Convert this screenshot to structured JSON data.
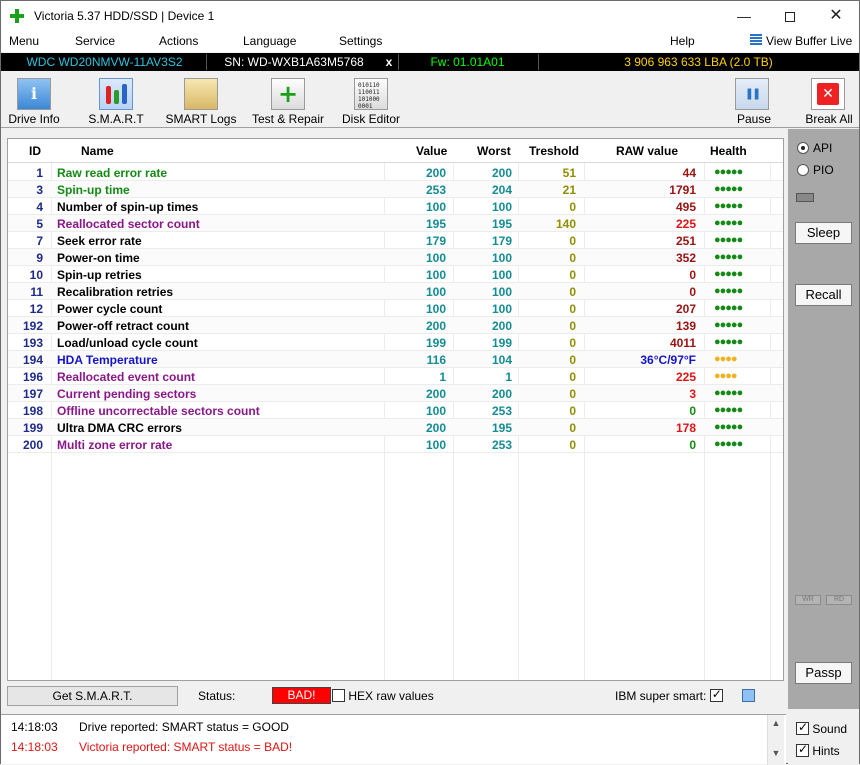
{
  "window": {
    "title": "Victoria 5.37 HDD/SSD | Device 1",
    "minimize": "—",
    "close": "✕"
  },
  "menu": [
    "Menu",
    "Service",
    "Actions",
    "Language",
    "Settings",
    "Help"
  ],
  "view_buffer": "View Buffer Live",
  "drive": {
    "model": "WDC WD20NMVW-11AV3S2",
    "serial": "SN: WD-WXB1A63M5768",
    "close": "x",
    "firmware": "Fw: 01.01A01",
    "lba": "3 906 963 633 LBA (2.0 TB)"
  },
  "toolbar": {
    "drive_info": "Drive Info",
    "smart": "S.M.A.R.T",
    "smart_logs": "SMART Logs",
    "test_repair": "Test & Repair",
    "disk_editor": "Disk Editor",
    "pause": "Pause",
    "break_all": "Break All"
  },
  "table": {
    "headers": {
      "id": "ID",
      "name": "Name",
      "value": "Value",
      "worst": "Worst",
      "threshold": "Treshold",
      "raw": "RAW value",
      "health": "Health"
    },
    "rows": [
      {
        "id": "1",
        "name": "Raw read error rate",
        "value": "200",
        "worst": "200",
        "threshold": "51",
        "raw": "44",
        "health": "●●●●●",
        "name_color": "#138a13",
        "raw_color": "#9a1313",
        "health_color": "#138a13"
      },
      {
        "id": "3",
        "name": "Spin-up time",
        "value": "253",
        "worst": "204",
        "threshold": "21",
        "raw": "1791",
        "health": "●●●●●",
        "name_color": "#138a13",
        "raw_color": "#9a1313",
        "health_color": "#138a13"
      },
      {
        "id": "4",
        "name": "Number of spin-up times",
        "value": "100",
        "worst": "100",
        "threshold": "0",
        "raw": "495",
        "health": "●●●●●",
        "name_color": "#000000",
        "raw_color": "#9a1313",
        "health_color": "#138a13"
      },
      {
        "id": "5",
        "name": "Reallocated sector count",
        "value": "195",
        "worst": "195",
        "threshold": "140",
        "raw": "225",
        "health": "●●●●●",
        "name_color": "#8a178a",
        "raw_color": "#e01414",
        "health_color": "#138a13"
      },
      {
        "id": "7",
        "name": "Seek error rate",
        "value": "179",
        "worst": "179",
        "threshold": "0",
        "raw": "251",
        "health": "●●●●●",
        "name_color": "#000000",
        "raw_color": "#9a1313",
        "health_color": "#138a13"
      },
      {
        "id": "9",
        "name": "Power-on time",
        "value": "100",
        "worst": "100",
        "threshold": "0",
        "raw": "352",
        "health": "●●●●●",
        "name_color": "#000000",
        "raw_color": "#9a1313",
        "health_color": "#138a13"
      },
      {
        "id": "10",
        "name": "Spin-up retries",
        "value": "100",
        "worst": "100",
        "threshold": "0",
        "raw": "0",
        "health": "●●●●●",
        "name_color": "#000000",
        "raw_color": "#9a1313",
        "health_color": "#138a13"
      },
      {
        "id": "11",
        "name": "Recalibration retries",
        "value": "100",
        "worst": "100",
        "threshold": "0",
        "raw": "0",
        "health": "●●●●●",
        "name_color": "#000000",
        "raw_color": "#9a1313",
        "health_color": "#138a13"
      },
      {
        "id": "12",
        "name": "Power cycle count",
        "value": "100",
        "worst": "100",
        "threshold": "0",
        "raw": "207",
        "health": "●●●●●",
        "name_color": "#000000",
        "raw_color": "#9a1313",
        "health_color": "#138a13"
      },
      {
        "id": "192",
        "name": "Power-off retract count",
        "value": "200",
        "worst": "200",
        "threshold": "0",
        "raw": "139",
        "health": "●●●●●",
        "name_color": "#000000",
        "raw_color": "#9a1313",
        "health_color": "#138a13"
      },
      {
        "id": "193",
        "name": "Load/unload cycle count",
        "value": "199",
        "worst": "199",
        "threshold": "0",
        "raw": "4011",
        "health": "●●●●●",
        "name_color": "#000000",
        "raw_color": "#9a1313",
        "health_color": "#138a13"
      },
      {
        "id": "194",
        "name": "HDA Temperature",
        "value": "116",
        "worst": "104",
        "threshold": "0",
        "raw": "36°C/97°F",
        "health": "●●●●",
        "name_color": "#1414c8",
        "raw_color": "#1414c8",
        "health_color": "#f2b01e"
      },
      {
        "id": "196",
        "name": "Reallocated event count",
        "value": "1",
        "worst": "1",
        "threshold": "0",
        "raw": "225",
        "health": "●●●●",
        "name_color": "#8a178a",
        "raw_color": "#e01414",
        "health_color": "#f2b01e"
      },
      {
        "id": "197",
        "name": "Current pending sectors",
        "value": "200",
        "worst": "200",
        "threshold": "0",
        "raw": "3",
        "health": "●●●●●",
        "name_color": "#8a178a",
        "raw_color": "#e01414",
        "health_color": "#138a13"
      },
      {
        "id": "198",
        "name": "Offline uncorrectable sectors count",
        "value": "100",
        "worst": "253",
        "threshold": "0",
        "raw": "0",
        "health": "●●●●●",
        "name_color": "#8a178a",
        "raw_color": "#138a13",
        "health_color": "#138a13"
      },
      {
        "id": "199",
        "name": "Ultra DMA CRC errors",
        "value": "200",
        "worst": "195",
        "threshold": "0",
        "raw": "178",
        "health": "●●●●●",
        "name_color": "#000000",
        "raw_color": "#e01414",
        "health_color": "#138a13"
      },
      {
        "id": "200",
        "name": "Multi zone error rate",
        "value": "100",
        "worst": "253",
        "threshold": "0",
        "raw": "0",
        "health": "●●●●●",
        "name_color": "#8a178a",
        "raw_color": "#138a13",
        "health_color": "#138a13"
      }
    ]
  },
  "right_panel": {
    "api": "API",
    "pio": "PIO",
    "api_selected": true,
    "sleep": "Sleep",
    "recall": "Recall",
    "wr": "WR",
    "rd": "RD",
    "passp": "Passp"
  },
  "statusbar": {
    "get_smart": "Get S.M.A.R.T.",
    "status_label": "Status:",
    "status_value": "BAD!",
    "hex_raw": "HEX raw values",
    "hex_checked": false,
    "ibm_super_smart": "IBM super smart:",
    "ibm_checked": true
  },
  "log": [
    {
      "time": "14:18:03",
      "message": "Drive reported: SMART status = GOOD",
      "color": "#000000"
    },
    {
      "time": "14:18:03",
      "message": "Victoria reported: SMART status = BAD!",
      "color": "#e01414"
    }
  ],
  "options": {
    "sound": "Sound",
    "sound_checked": true,
    "hints": "Hints",
    "hints_checked": true
  },
  "colors": {
    "bad": "#ff0000",
    "id": "#1d2a8a",
    "value": "#138c93",
    "threshold": "#8f8f00"
  }
}
